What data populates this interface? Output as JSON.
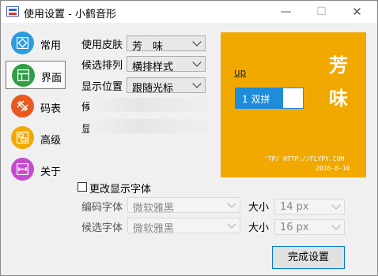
{
  "window": {
    "title": "使用设置 - 小鹤音形",
    "min": "—",
    "max": "☐",
    "close": "✕"
  },
  "nav": [
    {
      "label": "常用",
      "color": "#2c9be0",
      "icon": "diamond-icon"
    },
    {
      "label": "界面",
      "color": "#2f9e44",
      "icon": "layout-icon"
    },
    {
      "label": "码表",
      "color": "#e8591f",
      "icon": "crop-icon"
    },
    {
      "label": "高级",
      "color": "#f2a900",
      "icon": "panels-icon"
    },
    {
      "label": "关于",
      "color": "#c54bd0",
      "icon": "ruler-icon"
    }
  ],
  "form": {
    "skin_label": "使用皮肤",
    "skin_value": "芳　味",
    "order_label": "候选排列",
    "order_value": "横排样式",
    "pos_label": "显示位置",
    "pos_value": "跟随光标",
    "partial1": "候选",
    "partial2": "显"
  },
  "preview": {
    "bg": "#f1a900",
    "title_top": "芳",
    "title_bottom": "味",
    "input": "up",
    "cand_text": "1 双拼",
    "footer_url": "'TP/ HTTP://FLYPY.COM",
    "footer_date": "2016-8-10"
  },
  "fonts": {
    "change_label": "更改显示字体",
    "code_font_label": "编码字体",
    "code_font_value": "微软雅黑",
    "cand_font_label": "候选字体",
    "cand_font_value": "微软雅黑",
    "size_label": "大小",
    "code_size": "14 px",
    "cand_size": "16 px"
  },
  "finish_label": "完成设置"
}
